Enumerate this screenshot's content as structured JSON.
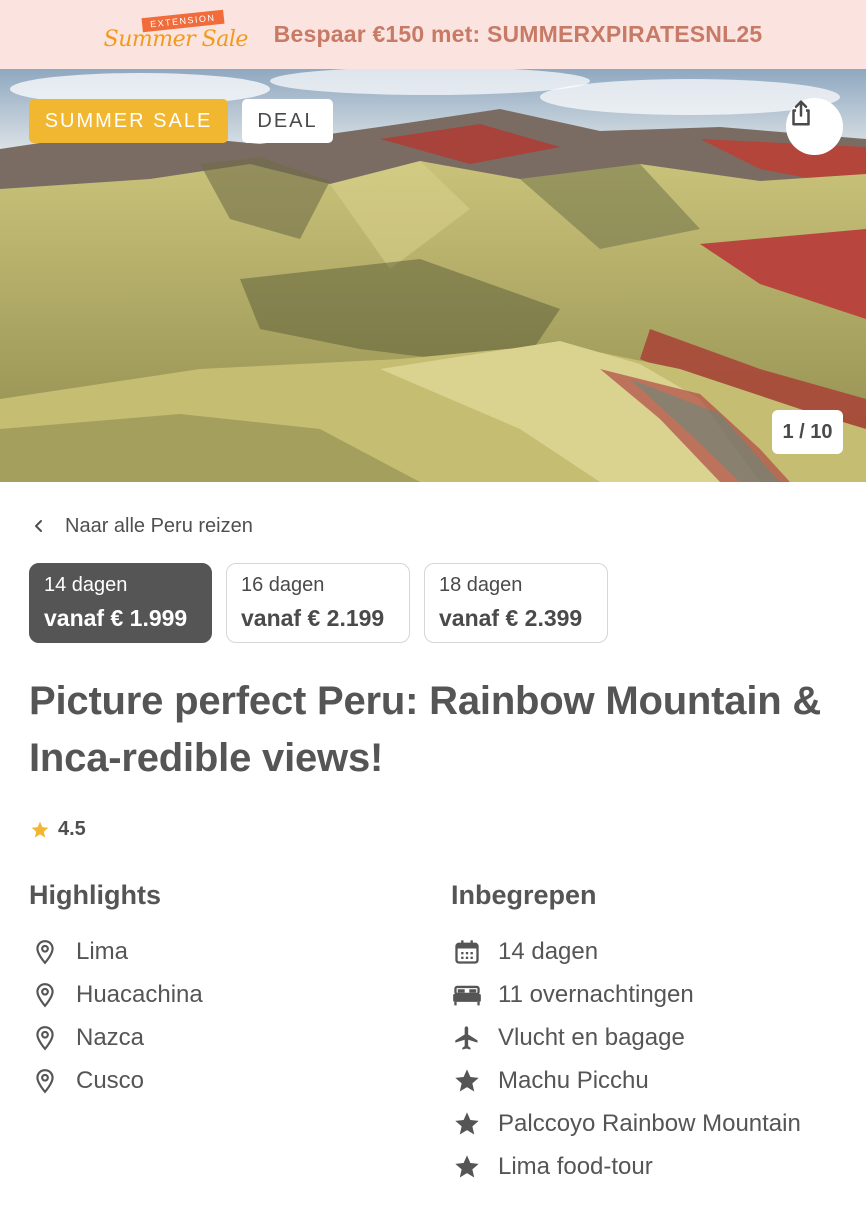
{
  "promo": {
    "logo_ribbon": "EXTENSION",
    "logo_script": "Summer Sale",
    "text": "Bespaar €150 met: SUMMERXPIRATESNL25"
  },
  "hero": {
    "badges": {
      "sale": "SUMMER SALE",
      "deal": "DEAL"
    },
    "share_icon": "share-icon",
    "counter": "1 / 10"
  },
  "back_link": {
    "label": "Naar alle Peru reizen",
    "icon": "chevron-left-icon"
  },
  "durations": [
    {
      "days": "14 dagen",
      "price": "vanaf € 1.999",
      "selected": true
    },
    {
      "days": "16 dagen",
      "price": "vanaf € 2.199",
      "selected": false
    },
    {
      "days": "18 dagen",
      "price": "vanaf € 2.399",
      "selected": false
    }
  ],
  "title": "Picture perfect Peru: Rainbow Mountain & Inca-redible views!",
  "rating": {
    "value": "4.5",
    "icon": "star-icon",
    "star_color": "#f1b730"
  },
  "highlights": {
    "heading": "Highlights",
    "items": [
      {
        "label": "Lima",
        "icon": "location-pin-icon"
      },
      {
        "label": "Huacachina",
        "icon": "location-pin-icon"
      },
      {
        "label": "Nazca",
        "icon": "location-pin-icon"
      },
      {
        "label": "Cusco",
        "icon": "location-pin-icon"
      }
    ]
  },
  "included": {
    "heading": "Inbegrepen",
    "items": [
      {
        "label": "14 dagen",
        "icon": "calendar-icon"
      },
      {
        "label": "11 overnachtingen",
        "icon": "bed-icon"
      },
      {
        "label": "Vlucht en bagage",
        "icon": "airplane-icon"
      },
      {
        "label": "Machu Picchu",
        "icon": "star-icon"
      },
      {
        "label": "Palccoyo Rainbow Mountain",
        "icon": "star-icon"
      },
      {
        "label": "Lima food-tour",
        "icon": "star-icon"
      }
    ]
  },
  "colors": {
    "promo_bg": "#fbe3df",
    "promo_text": "#c77a66",
    "sale_badge": "#f1b730",
    "selected_duration": "#555555",
    "text": "#555555"
  }
}
